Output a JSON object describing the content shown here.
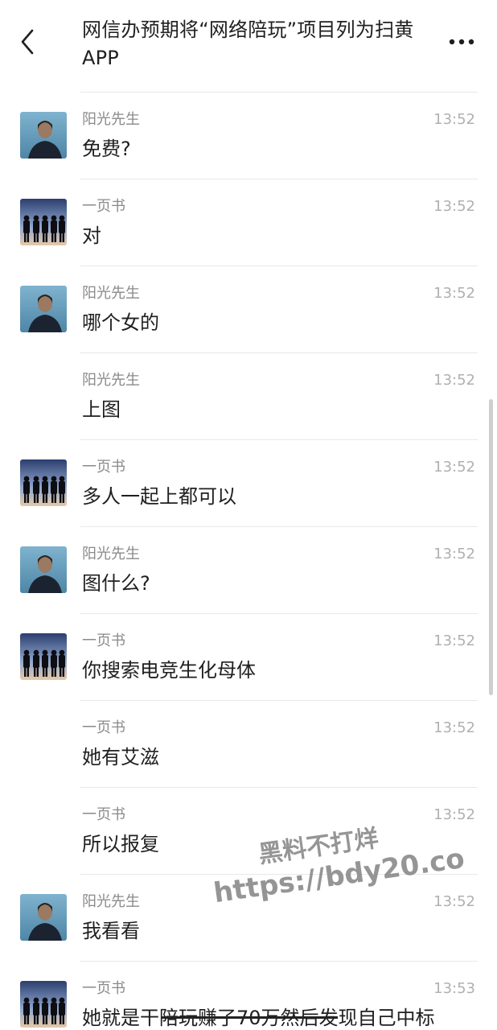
{
  "header": {
    "title": "网信办预期将“网络陪玩”项目列为扫黄APP",
    "back_icon": "chevron-left-icon",
    "more_icon": "more-horizontal-icon"
  },
  "messages": [
    {
      "sender": "阳光先生",
      "time": "13:52",
      "content": "免费?",
      "avatar": "man-portrait"
    },
    {
      "sender": "一页书",
      "time": "13:52",
      "content": "对",
      "avatar": "group-silhouette"
    },
    {
      "sender": "阳光先生",
      "time": "13:52",
      "content": "哪个女的",
      "avatar": "man-portrait"
    },
    {
      "sender": "阳光先生",
      "time": "13:52",
      "content": "上图",
      "avatar": ""
    },
    {
      "sender": "一页书",
      "time": "13:52",
      "content": "多人一起上都可以",
      "avatar": "group-silhouette"
    },
    {
      "sender": "阳光先生",
      "time": "13:52",
      "content": "图什么?",
      "avatar": "man-portrait"
    },
    {
      "sender": "一页书",
      "time": "13:52",
      "content": "你搜索电竞生化母体",
      "avatar": "group-silhouette"
    },
    {
      "sender": "一页书",
      "time": "13:52",
      "content": "她有艾滋",
      "avatar": ""
    },
    {
      "sender": "一页书",
      "time": "13:52",
      "content": "所以报复",
      "avatar": ""
    },
    {
      "sender": "阳光先生",
      "time": "13:52",
      "content": "我看看",
      "avatar": "man-portrait"
    },
    {
      "sender": "一页书",
      "time": "13:53",
      "content": "她就是干陪玩赚了70万然后发现自己中标",
      "avatar": "group-silhouette"
    }
  ],
  "watermark": {
    "line1": "黑料不打烊",
    "line2": "https://bdy20.co"
  },
  "colors": {
    "background": "#ffffff",
    "text": "#1f1f1f",
    "sender": "#8a8a8a",
    "time": "#b0b0b0",
    "divider": "#e8e8e8"
  }
}
